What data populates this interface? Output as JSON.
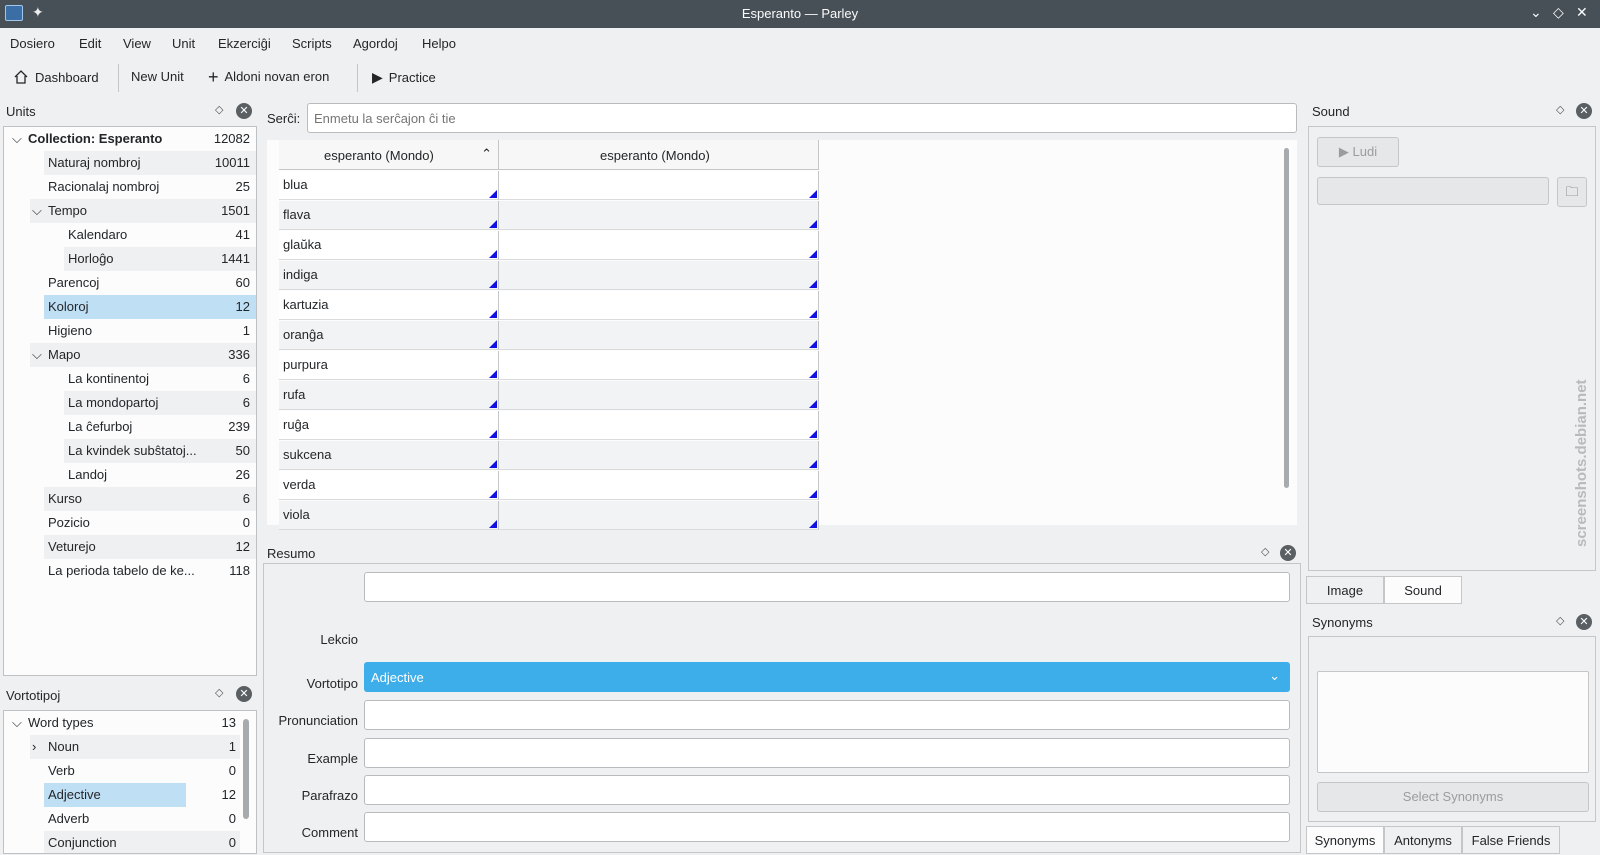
{
  "window": {
    "title": "Esperanto — Parley"
  },
  "menu": [
    "Dosiero",
    "Edit",
    "View",
    "Unit",
    "Ekzerciĝi",
    "Scripts",
    "Agordoj",
    "Helpo"
  ],
  "toolbar": {
    "dashboard": "Dashboard",
    "new_unit": "New Unit",
    "add_entry": "Aldoni novan eron",
    "practice": "Practice"
  },
  "units_panel": {
    "title": "Units",
    "items": [
      {
        "label": "Collection: Esperanto",
        "count": "12082"
      },
      {
        "label": "Naturaj nombroj",
        "count": "10011"
      },
      {
        "label": "Racionalaj nombroj",
        "count": "25"
      },
      {
        "label": "Tempo",
        "count": "1501"
      },
      {
        "label": "Kalendaro",
        "count": "41"
      },
      {
        "label": "Horloĝo",
        "count": "1441"
      },
      {
        "label": "Parencoj",
        "count": "60"
      },
      {
        "label": "Koloroj",
        "count": "12"
      },
      {
        "label": "Higieno",
        "count": "1"
      },
      {
        "label": "Mapo",
        "count": "336"
      },
      {
        "label": "La kontinentoj",
        "count": "6"
      },
      {
        "label": "La mondopartoj",
        "count": "6"
      },
      {
        "label": "La ĉefurboj",
        "count": "239"
      },
      {
        "label": "La kvindek subŝtatoj...",
        "count": "50"
      },
      {
        "label": "Landoj",
        "count": "26"
      },
      {
        "label": "Kurso",
        "count": "6"
      },
      {
        "label": "Pozicio",
        "count": "0"
      },
      {
        "label": "Veturejo",
        "count": "12"
      },
      {
        "label": "La perioda tabelo de ke...",
        "count": "118"
      }
    ]
  },
  "wordtypes_panel": {
    "title": "Vortotipoj",
    "items": [
      {
        "label": "Word types",
        "count": "13"
      },
      {
        "label": "Noun",
        "count": "1"
      },
      {
        "label": "Verb",
        "count": "0"
      },
      {
        "label": "Adjective",
        "count": "12"
      },
      {
        "label": "Adverb",
        "count": "0"
      },
      {
        "label": "Conjunction",
        "count": "0"
      }
    ]
  },
  "search": {
    "label": "Serĉi:",
    "placeholder": "Enmetu la serĉajon ĉi tie"
  },
  "table": {
    "columns": [
      "esperanto (Mondo)",
      "esperanto (Mondo)"
    ],
    "rows": [
      "blua",
      "flava",
      "glaŭka",
      "indiga",
      "kartuzia",
      "oranĝa",
      "purpura",
      "rufa",
      "ruĝa",
      "sukcena",
      "verda",
      "viola"
    ]
  },
  "summary": {
    "title": "Resumo",
    "lesson_label": "Lekcio",
    "wordtype_label": "Vortotipo",
    "wordtype_value": "Adjective",
    "pronunciation_label": "Pronunciation",
    "example_label": "Example",
    "paraphrase_label": "Parafrazo",
    "comment_label": "Comment"
  },
  "sound_panel": {
    "title": "Sound",
    "play_label": "Ludi"
  },
  "media_tabs": [
    "Image",
    "Sound"
  ],
  "synonyms_panel": {
    "title": "Synonyms",
    "select_button": "Select Synonyms"
  },
  "bottom_tabs": [
    "Synonyms",
    "Antonyms",
    "False Friends"
  ],
  "watermark": "screenshots.debian.net"
}
